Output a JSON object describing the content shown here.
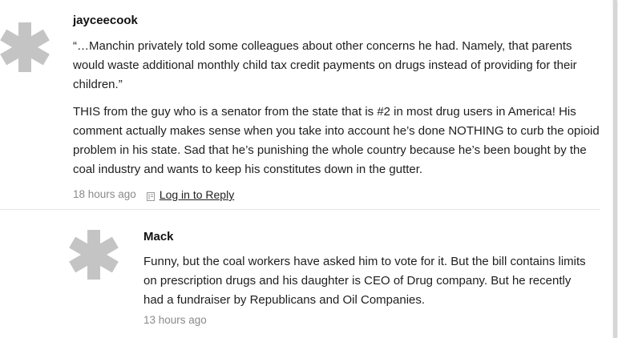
{
  "comments": [
    {
      "author": "jayceecook",
      "avatar_icon": "asterisk-avatar-icon",
      "paragraphs": [
        "“…Manchin privately told some colleagues about other concerns he had. Namely, that parents would waste additional monthly child tax credit payments on drugs instead of providing for their children.”",
        "THIS from the guy who is a senator from the state that is #2 in most drug users in America! His comment actually makes sense when you take into account he’s done NOTHING to curb the opioid problem in his state. Sad that he’s punishing the whole country because he’s been bought by the coal industry and wants to keep his constitutes down in the gutter."
      ],
      "timestamp": "18 hours ago",
      "reply_label": "Log in to Reply"
    },
    {
      "author": "Mack",
      "avatar_icon": "asterisk-avatar-icon",
      "paragraphs": [
        "Funny, but the coal workers have asked him to vote for it. But the bill contains limits on prescription drugs and his daughter is CEO of Drug company. But he recently had a fundraiser by Republicans and Oil Companies."
      ],
      "timestamp": "13 hours ago"
    }
  ],
  "colors": {
    "avatar": "#c4c4c4",
    "text": "#1e1e1e",
    "meta": "#8a8a8a",
    "divider": "#e6e6e6"
  }
}
